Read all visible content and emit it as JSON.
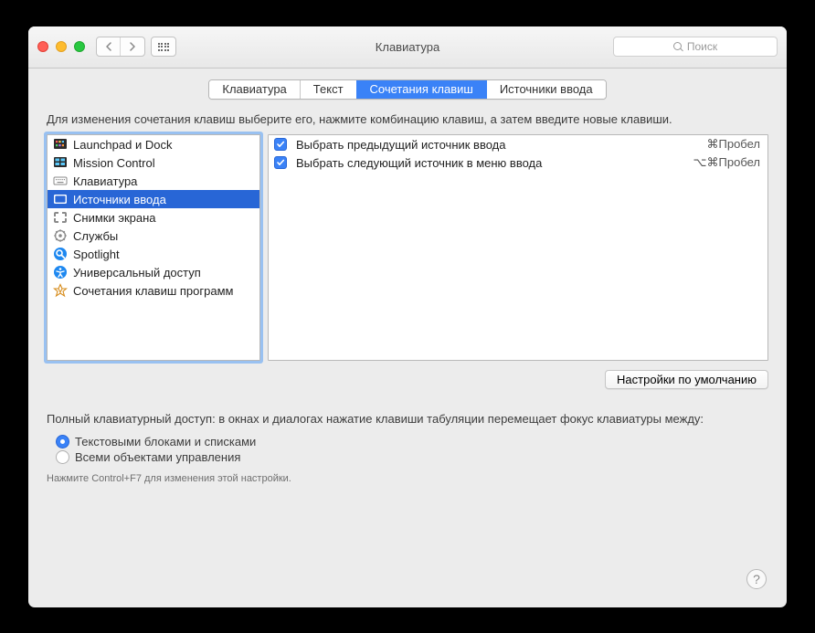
{
  "window": {
    "title": "Клавиатура",
    "search_placeholder": "Поиск"
  },
  "tabs": [
    {
      "label": "Клавиатура",
      "active": false
    },
    {
      "label": "Текст",
      "active": false
    },
    {
      "label": "Сочетания клавиш",
      "active": true
    },
    {
      "label": "Источники ввода",
      "active": false
    }
  ],
  "description": "Для изменения сочетания клавиш выберите его, нажмите комбинацию клавиш, а затем введите новые клавиши.",
  "categories": [
    {
      "label": "Launchpad и Dock",
      "icon": "launchpad",
      "selected": false
    },
    {
      "label": "Mission Control",
      "icon": "mission-control",
      "selected": false
    },
    {
      "label": "Клавиатура",
      "icon": "keyboard",
      "selected": false
    },
    {
      "label": "Источники ввода",
      "icon": "input-source",
      "selected": true
    },
    {
      "label": "Снимки экрана",
      "icon": "screenshot",
      "selected": false
    },
    {
      "label": "Службы",
      "icon": "services",
      "selected": false
    },
    {
      "label": "Spotlight",
      "icon": "spotlight",
      "selected": false
    },
    {
      "label": "Универсальный доступ",
      "icon": "accessibility",
      "selected": false
    },
    {
      "label": "Сочетания клавиш программ",
      "icon": "app-shortcuts",
      "selected": false
    }
  ],
  "shortcuts": [
    {
      "label": "Выбрать предыдущий источник ввода",
      "key": "⌘Пробел",
      "checked": true
    },
    {
      "label": "Выбрать следующий источник в меню ввода",
      "key": "⌥⌘Пробел",
      "checked": true
    }
  ],
  "defaults_button": "Настройки по умолчанию",
  "tab_access": {
    "header": "Полный клавиатурный доступ: в окнах и диалогах нажатие клавиши табуляции перемещает фокус клавиатуры между:",
    "options": [
      {
        "label": "Текстовыми блоками и списками",
        "selected": true
      },
      {
        "label": "Всеми объектами управления",
        "selected": false
      }
    ],
    "hint": "Нажмите Control+F7 для изменения этой настройки."
  },
  "help_glyph": "?"
}
